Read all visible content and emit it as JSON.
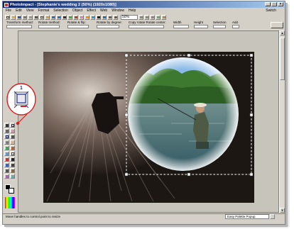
{
  "window": {
    "title": "PhotoImpact - [Stephanie's wedding 2 (50%) (1920x1080)]",
    "controls": [
      "_",
      "□",
      "×"
    ]
  },
  "menu": {
    "items": [
      "File",
      "Edit",
      "View",
      "Format",
      "Selection",
      "Object",
      "Effect",
      "Web",
      "Window",
      "Help"
    ]
  },
  "switch_label": "Switch",
  "toolbar": {
    "zoom_value": "50%"
  },
  "attributes": {
    "labels": [
      "Transform method:",
      "Rotate method:",
      "Rotate & flip:",
      "Rotate by degree:",
      "Copy rotate Rotate center:",
      "Width",
      "Height",
      "Selection",
      "Add"
    ]
  },
  "callout": {
    "number": "1"
  },
  "status": {
    "left_text": "Move handles to control point to resize",
    "right_text": "Easy Palette Popup"
  },
  "colors": {
    "title_start": "#0a246a",
    "title_end": "#a6caf0",
    "callout_red": "#d42020",
    "selection_dash": "#ffffff"
  }
}
